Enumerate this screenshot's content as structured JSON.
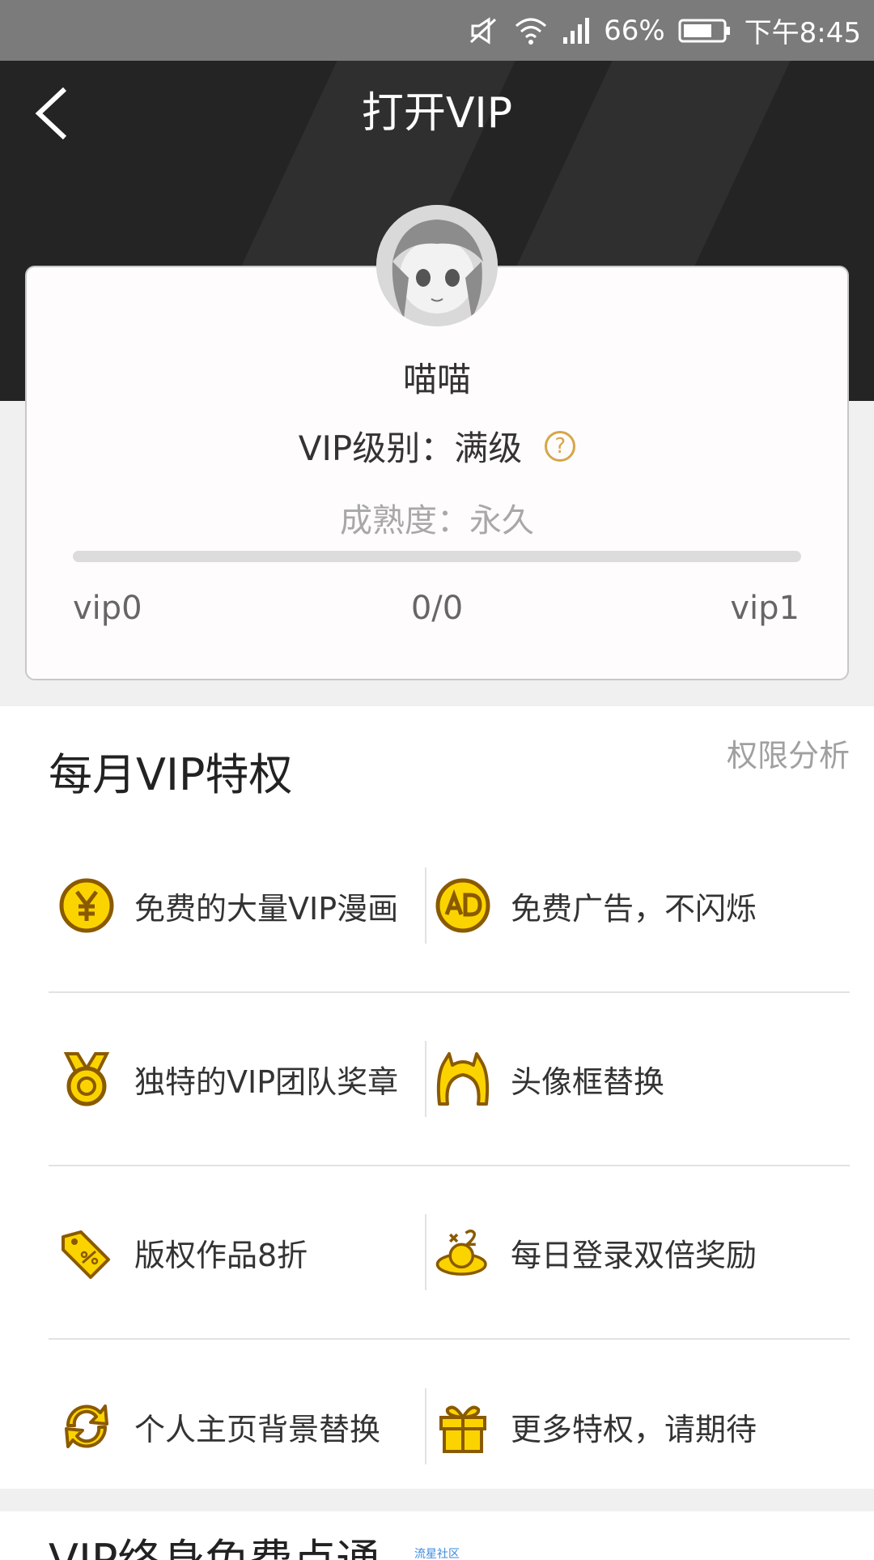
{
  "status_bar": {
    "battery": "66%",
    "time": "下午8:45",
    "icons": [
      "mute-icon",
      "wifi-icon",
      "signal-icon",
      "battery-icon"
    ]
  },
  "header": {
    "title": "打开VIP",
    "back_icon": "chevron-left-icon"
  },
  "profile": {
    "username": "喵喵",
    "vip_level_text": "VIP级别：满级",
    "maturity_text": "成熟度：永久",
    "progress": {
      "fraction": 0,
      "left_label": "vip0",
      "middle_label": "0/0",
      "right_label": "vip1"
    }
  },
  "privileges": {
    "title": "每月VIP特权",
    "link": "权限分析",
    "items": [
      {
        "label": "免费的大量VIP漫画",
        "icon": "yen-icon"
      },
      {
        "label": "免费广告，不闪烁",
        "icon": "ad-icon"
      },
      {
        "label": "独特的VIP团队奖章",
        "icon": "medal-icon"
      },
      {
        "label": "头像框替换",
        "icon": "avatar-frame-icon"
      },
      {
        "label": "版权作品8折",
        "icon": "tag-discount-icon"
      },
      {
        "label": "每日登录双倍奖励",
        "icon": "double-reward-icon"
      },
      {
        "label": "个人主页背景替换",
        "icon": "refresh-icon"
      },
      {
        "label": "更多特权，请期待",
        "icon": "gift-icon"
      }
    ]
  },
  "next_section": {
    "title": "VIP终身免费点通",
    "tag": "流星社区"
  },
  "colors": {
    "accent_gold": "#fbd400",
    "icon_outline": "#8a5a00",
    "header_bg": "#242424",
    "help_gold": "#d6a647"
  }
}
